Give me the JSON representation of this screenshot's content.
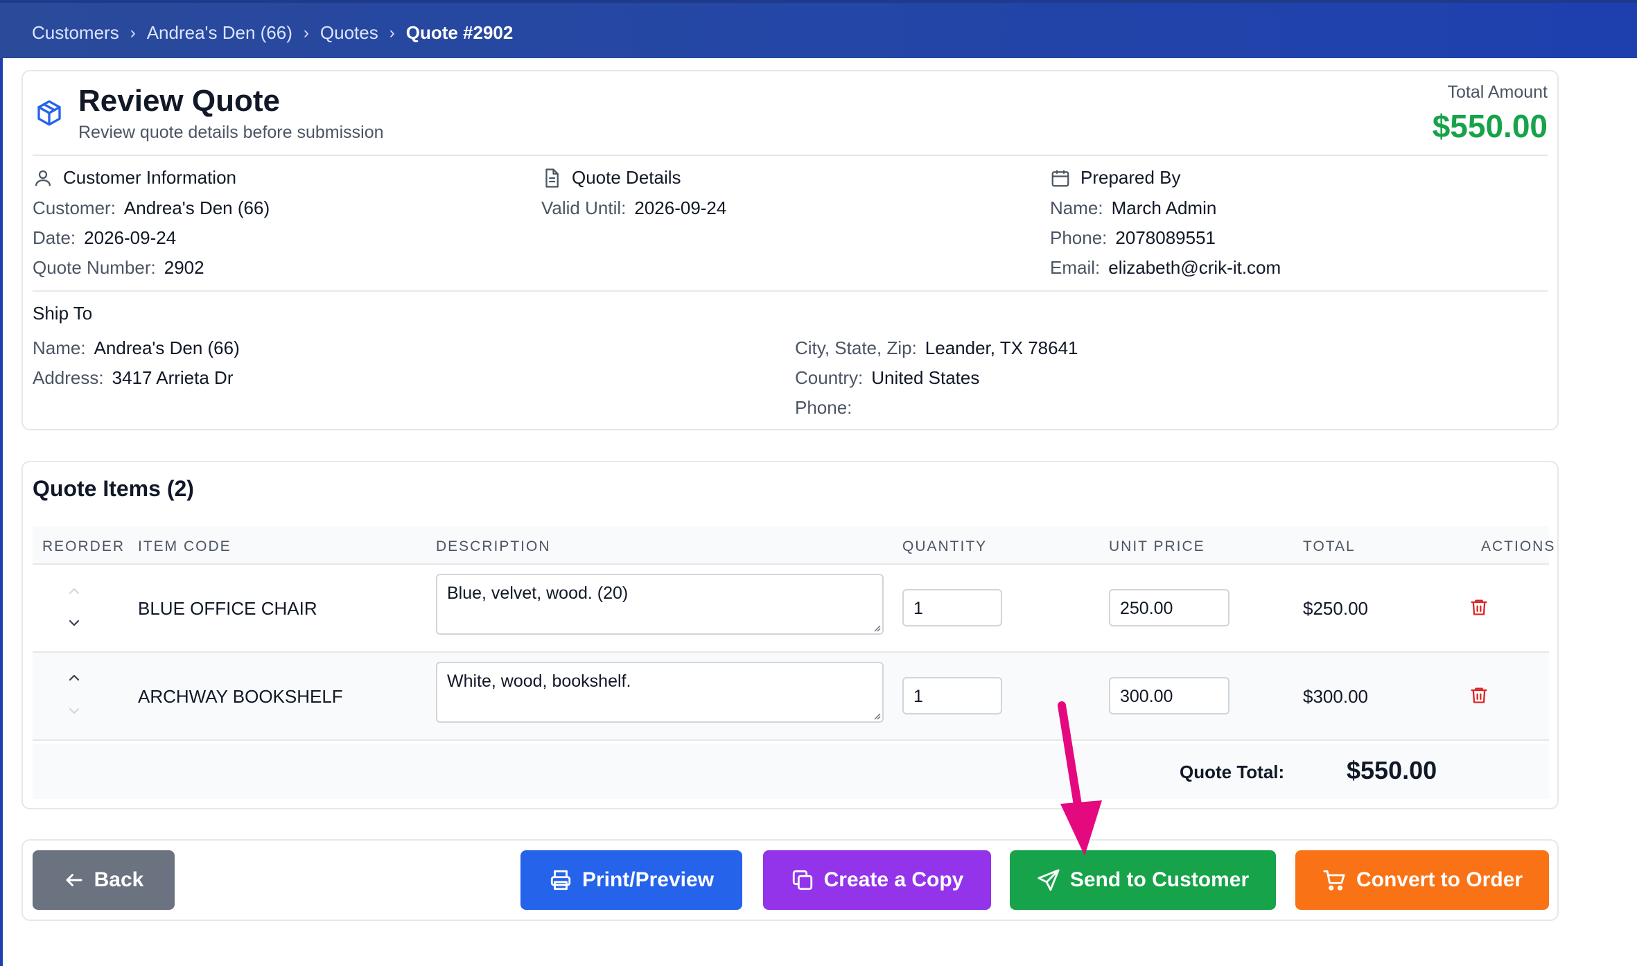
{
  "breadcrumb": {
    "items": [
      "Customers",
      "Andrea's Den (66)",
      "Quotes"
    ],
    "current": "Quote #2902",
    "separator": "›"
  },
  "header": {
    "title": "Review Quote",
    "subtitle": "Review quote details before submission",
    "total_label": "Total Amount",
    "total_amount": "$550.00",
    "icon": "package-icon"
  },
  "customer_info": {
    "heading": "Customer Information",
    "icon": "user-icon",
    "fields": [
      {
        "label": "Customer:",
        "value": "Andrea's Den (66)"
      },
      {
        "label": "Date:",
        "value": "2026-09-24"
      },
      {
        "label": "Quote Number:",
        "value": "2902"
      }
    ]
  },
  "quote_details": {
    "heading": "Quote Details",
    "icon": "document-icon",
    "fields": [
      {
        "label": "Valid Until:",
        "value": "2026-09-24"
      }
    ]
  },
  "prepared_by": {
    "heading": "Prepared By",
    "icon": "calendar-icon",
    "fields": [
      {
        "label": "Name:",
        "value": "March Admin"
      },
      {
        "label": "Phone:",
        "value": "2078089551"
      },
      {
        "label": "Email:",
        "value": "elizabeth@crik-it.com"
      }
    ]
  },
  "ship_to": {
    "heading": "Ship To",
    "left": [
      {
        "label": "Name:",
        "value": "Andrea's Den (66)"
      },
      {
        "label": "Address:",
        "value": "3417 Arrieta Dr"
      }
    ],
    "right": [
      {
        "label": "City, State, Zip:",
        "value": "Leander, TX 78641"
      },
      {
        "label": "Country:",
        "value": "United States"
      },
      {
        "label": "Phone:",
        "value": ""
      }
    ]
  },
  "items": {
    "title": "Quote Items (2)",
    "columns": [
      "REORDER",
      "ITEM CODE",
      "DESCRIPTION",
      "QUANTITY",
      "UNIT PRICE",
      "TOTAL",
      "ACTIONS"
    ],
    "rows": [
      {
        "code": "BLUE OFFICE CHAIR",
        "description": "Blue, velvet, wood. (20)",
        "quantity": "1",
        "unit_price": "250.00",
        "total": "$250.00"
      },
      {
        "code": "ARCHWAY BOOKSHELF",
        "description": "White, wood, bookshelf.",
        "quantity": "1",
        "unit_price": "300.00",
        "total": "$300.00"
      }
    ],
    "quote_total_label": "Quote Total:",
    "quote_total_value": "$550.00"
  },
  "actions": {
    "back": "Back",
    "print": "Print/Preview",
    "copy": "Create a Copy",
    "send": "Send to Customer",
    "convert": "Convert to Order"
  },
  "colors": {
    "header_bar": "#1e40af",
    "total_green": "#16a34a",
    "back": "#6b7280",
    "print": "#2563eb",
    "copy": "#9333ea",
    "send": "#16a34a",
    "convert": "#f97316",
    "delete_red": "#dc2626",
    "pointer_arrow": "#e5097f"
  }
}
